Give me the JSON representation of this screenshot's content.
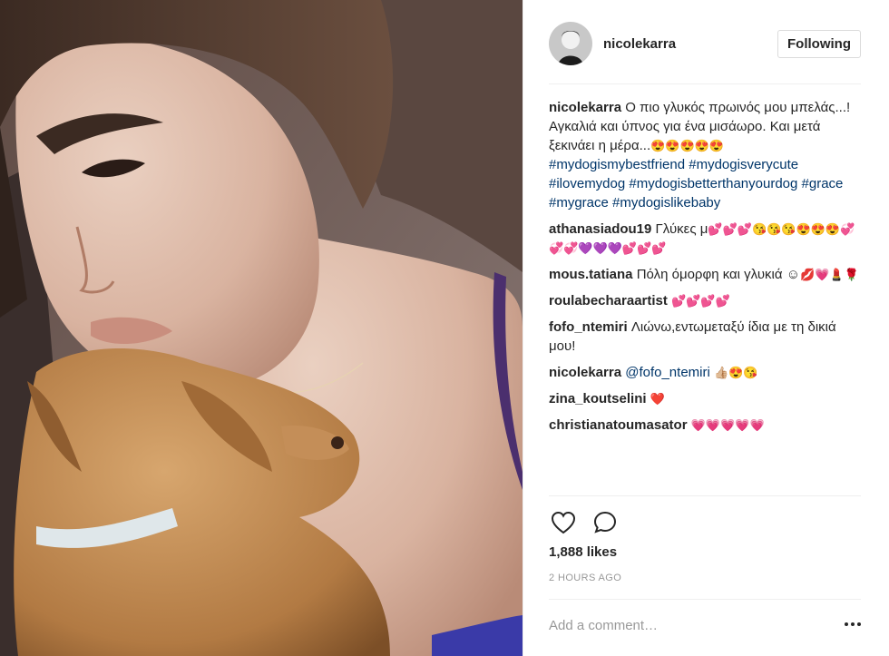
{
  "post": {
    "author": "nicolekarra",
    "follow_label": "Following",
    "likes": "1,888 likes",
    "time": "2 HOURS AGO",
    "comment_placeholder": "Add a comment…",
    "photo_icon": "selfie-with-puppy-photo"
  },
  "caption": {
    "user": "nicolekarra",
    "text": "Ο πιο γλυκός πρωινός μου μπελάς...! Αγκαλιά και ύπνος για ένα μισάωρο. Και μετά ξεκινάει η μέρα...",
    "emojis": "😍😍😍😍😍",
    "hashtags": [
      "#mydogismybestfriend",
      "#mydogisverycute",
      "#ilovemydog",
      "#mydogisbetterthanyourdog",
      "#grace",
      "#mygrace",
      "#mydogislikebaby"
    ]
  },
  "comments": [
    {
      "user": "athanasiadou19",
      "text": "Γλύκες μ",
      "emojis": "💕💕💕😘😘😘😍😍😍💞💞💞💜💜💜💕💕💕"
    },
    {
      "user": "mous.tatiana",
      "text": "Πόλη όμορφη και γλυκιά ☺",
      "emojis": "💋💗💄🌹"
    },
    {
      "user": "roulabecharaartist",
      "text": "",
      "emojis": "💕💕💕💕"
    },
    {
      "user": "fofo_ntemiri",
      "text": "Λιώνω,εντωμεταξύ ίδια με τη δικιά μου!",
      "emojis": ""
    },
    {
      "user": "nicolekarra",
      "mention": "@fofo_ntemiri",
      "text": "",
      "emojis": "👍🏼😍😘"
    },
    {
      "user": "zina_koutselini",
      "text": "",
      "emojis": "❤️"
    },
    {
      "user": "christianatoumasator",
      "text": "",
      "emojis": "💗💗💗💗💗"
    }
  ],
  "icons": {
    "like": "heart-outline-icon",
    "comment": "speech-bubble-icon",
    "more": "more-options-icon"
  },
  "colors": {
    "link": "#003569",
    "muted": "#999999",
    "text": "#262626",
    "border": "#efefef"
  }
}
